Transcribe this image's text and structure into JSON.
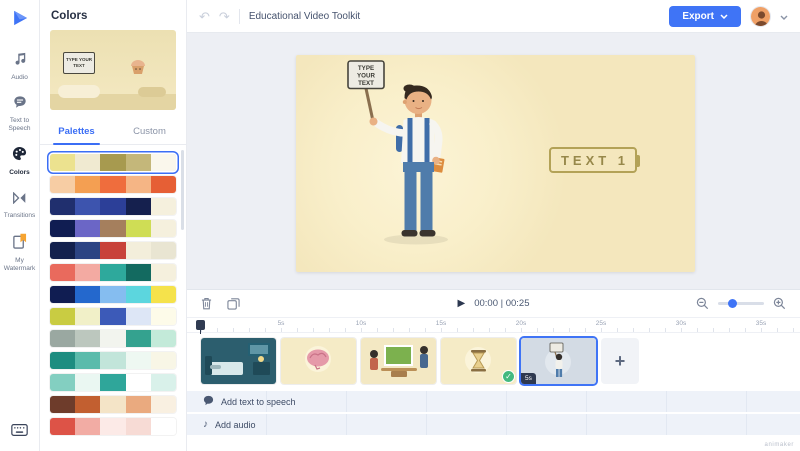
{
  "sidebar": {
    "items": [
      {
        "label": "Audio"
      },
      {
        "label": "Text to Speech"
      },
      {
        "label": "Colors",
        "active": true
      },
      {
        "label": "Transitions"
      },
      {
        "label": "My Watermark"
      }
    ]
  },
  "colors_panel": {
    "title": "Colors",
    "tabs": [
      {
        "label": "Palettes",
        "active": true
      },
      {
        "label": "Custom"
      }
    ],
    "preview_sign_text": "TYPE YOUR TEXT",
    "palettes": [
      {
        "selected": true,
        "colors": [
          "#ece28f",
          "#f0ead1",
          "#a79a4f",
          "#c4b77a",
          "#faf7ec"
        ]
      },
      {
        "colors": [
          "#f7cda4",
          "#f49f52",
          "#ef6d3d",
          "#f5b585",
          "#e65f35"
        ]
      },
      {
        "colors": [
          "#202f6e",
          "#3d54ae",
          "#2c3f98",
          "#15204e",
          "#f5f0dd"
        ]
      },
      {
        "colors": [
          "#101d52",
          "#6b66c6",
          "#a57f5d",
          "#cfdd55",
          "#f5f0dd"
        ]
      },
      {
        "colors": [
          "#13214d",
          "#2c4483",
          "#c8423a",
          "#f3eedb",
          "#e9e5d2"
        ]
      },
      {
        "colors": [
          "#e96a5d",
          "#f3aaa2",
          "#2ea99c",
          "#136a60",
          "#f5f0dd"
        ]
      },
      {
        "colors": [
          "#101d52",
          "#2468cd",
          "#85bdf0",
          "#5cd6de",
          "#f5e24b"
        ]
      },
      {
        "colors": [
          "#c9cc42",
          "#f1f0c8",
          "#3c5ab8",
          "#dde6f6",
          "#fdfbe9"
        ]
      },
      {
        "colors": [
          "#9aa8a1",
          "#bcc7be",
          "#f2f4ee",
          "#34a28f",
          "#c3ead9"
        ]
      },
      {
        "colors": [
          "#1d8d80",
          "#5bbbab",
          "#c2e5da",
          "#eef8f2",
          "#f8f6e6"
        ]
      },
      {
        "colors": [
          "#83cfc1",
          "#eaf7f2",
          "#2fa69a",
          "#ffffff",
          "#d9f1ea"
        ]
      },
      {
        "colors": [
          "#6e3c2b",
          "#c25f30",
          "#f4e4c7",
          "#eaaa7f",
          "#f9f0e1"
        ]
      },
      {
        "colors": [
          "#dd5347",
          "#f2aca4",
          "#fceae7",
          "#f7dbd5",
          "#ffffff"
        ]
      }
    ]
  },
  "topbar": {
    "title": "Educational Video Toolkit",
    "export_label": "Export"
  },
  "canvas": {
    "sign_lines": [
      "TYPE",
      "YOUR",
      "TEXT"
    ],
    "text_box_label": "TEXT 1"
  },
  "timeline": {
    "time_display": "00:00 | 00:25",
    "ruler_labels": [
      "5s",
      "10s",
      "15s",
      "20s",
      "25s",
      "30s",
      "35s"
    ],
    "scenes": [
      {
        "kind": "bedroom"
      },
      {
        "kind": "brain"
      },
      {
        "kind": "whiteboard"
      },
      {
        "kind": "hourglass",
        "completed": true
      },
      {
        "kind": "sign",
        "selected": true,
        "duration": "5s"
      }
    ],
    "add_scene_label": "+",
    "tts_label": "Add text to speech",
    "audio_label": "Add audio"
  },
  "icons": {
    "check": "✓",
    "play": "▶",
    "undo": "↶",
    "redo": "↷",
    "music_note": "♪"
  },
  "colors": {
    "accent": "#3f74f6",
    "canvas_bg": "#f6ebc5"
  },
  "watermark": "animaker"
}
